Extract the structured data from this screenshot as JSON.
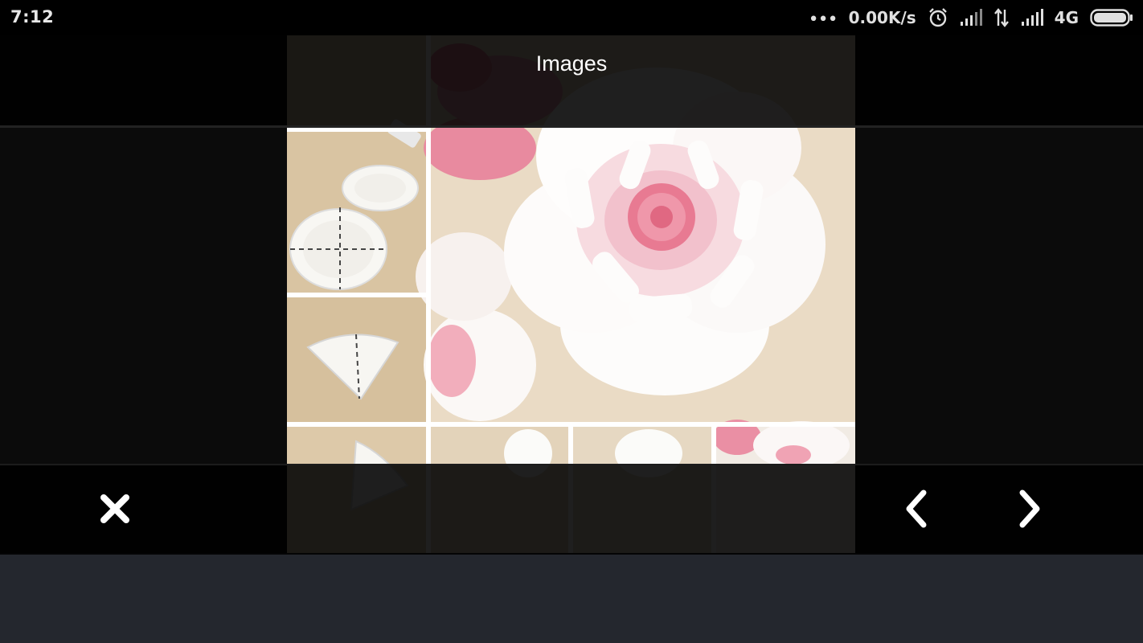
{
  "status_bar": {
    "time": "7:12",
    "overflow_dots": "•••",
    "net_speed": "0.00K/s",
    "network_type": "4G",
    "icons": [
      "alarm-icon",
      "signal-icon",
      "data-transfer-icon",
      "signal-icon",
      "battery-icon"
    ]
  },
  "header": {
    "title": "Images"
  },
  "toolbar": {
    "close_icon": "close-icon",
    "prev_icon": "chevron-left-icon",
    "next_icon": "chevron-right-icon"
  },
  "colors": {
    "status_bar_bg": "#000000",
    "viewer_bg": "#0b0b0b",
    "overlay_bg": "#000000",
    "footer_bg": "#24272e",
    "icon": "#ffffff",
    "flower_pink": "#e87a92"
  }
}
